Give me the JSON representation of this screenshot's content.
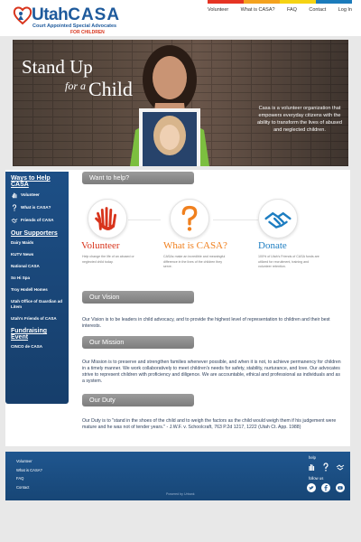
{
  "logo": {
    "utah": "Utah",
    "casa": "CASA",
    "sub1": "Court Appointed Special Advocates",
    "sub2": "FOR CHILDREN"
  },
  "nav": [
    "Volunteer",
    "What is CASA?",
    "FAQ",
    "Contact",
    "Log In"
  ],
  "colors": {
    "bar1": "#e53423",
    "bar2": "#f4a21f",
    "bar3": "#f5d313",
    "bar4": "#1b7bbb",
    "accent_red": "#d8341c",
    "accent_orange": "#f0801e",
    "accent_blue": "#1d7dc1",
    "navy": "#1d4f86"
  },
  "hero": {
    "title1": "Stand Up",
    "title2": "for a",
    "title3": "Child",
    "text": "Casa is a volunteer organization that empowers everyday citizens with the ability to transform the lives of abused and neglected children."
  },
  "sidebar": {
    "ways_heading": "Ways to Help CASA",
    "ways_items": [
      {
        "label": "Volunteer",
        "icon": "hand-icon"
      },
      {
        "label": "What is CASA?",
        "icon": "question-icon"
      },
      {
        "label": "Friends of CASA",
        "icon": "handshake-icon"
      }
    ],
    "supporters_heading": "Our Supporters",
    "supporters": [
      "Dairy Maids",
      "KUTV News",
      "National CASA",
      "So Hi Spa",
      "Troy Hodell Homes",
      "Utah Office of Guardian ad Litem",
      "Utah's Friends of CASA"
    ],
    "events_heading": "Fundraising Event",
    "events": [
      "CINCO de CASA"
    ]
  },
  "help": {
    "heading": "Want to help?",
    "columns": [
      {
        "title": "Volunteer",
        "text": "Help change the life of an abused or neglected child today.",
        "icon": "hand-icon",
        "color": "#d8341c"
      },
      {
        "title": "What is CASA?",
        "text": "CASAs make an incredible and meaningful difference in the lives of the children they serve.",
        "icon": "question-icon",
        "color": "#f0801e"
      },
      {
        "title": "Donate",
        "text": "100% of Utah's Friends of CASA funds are utilized for recruitment, training and volunteer retention.",
        "icon": "handshake-icon",
        "color": "#1d7dc1"
      }
    ]
  },
  "vision": {
    "heading": "Our Vision",
    "text": "Our Vision is to be leaders in child advocacy, and to provide the highest level of representation to children and their best interests."
  },
  "mission": {
    "heading": "Our Mission",
    "text": "Our Mission is to preserve and strengthen families whenever possible, and when it is not, to achieve permanency for children in a timely manner. We work collaboratively to meet children's needs for safety, stability, nurturance, and love. Our advocates strive to represent children with proficiency and diligence. We are accountable, ethical and professional as individuals and as a system."
  },
  "duty": {
    "heading": "Our Duty",
    "text": "Our Duty is to \"stand in the shoes of the child and to weigh the factors as the child would weigh them if his judgement were mature and he was not of tender years.\" - J.W.F. v. Schoolcraft, 763 P.2d 1217, 1222 (Utah Ct. App. 1988)"
  },
  "footer": {
    "links": [
      "Volunteer",
      "What is CASA?",
      "FAQ",
      "Contact"
    ],
    "help_label": "help",
    "follow_label": "follow us",
    "powered": "Powered by Urbank"
  }
}
